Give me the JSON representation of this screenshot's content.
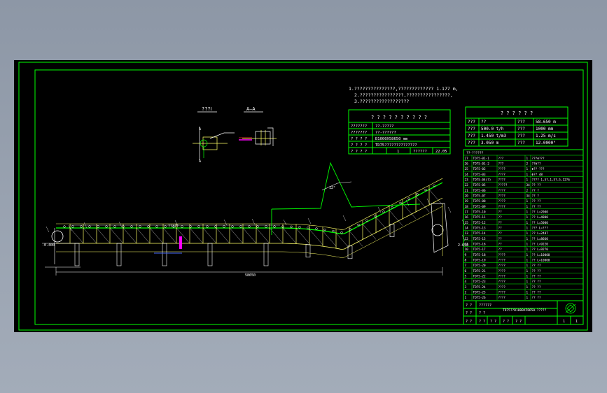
{
  "colors": {
    "background": "#000000",
    "frame": "#00ff00",
    "geometry": "#ffff66",
    "text": "#ffffff",
    "accent": "#ff00ff",
    "blue_line": "#4466ff",
    "canvas": "#9aa4b2"
  },
  "notes": {
    "line1": "1.???????????????,????????????? 1.177 m,",
    "line2": "2.????????????????,????????????????,",
    "line3": "3.??????????????????"
  },
  "section_labels": {
    "view1": "???Ⅰ",
    "view2": "A–A"
  },
  "spec_table": {
    "title": "? ? ? ? ? ? ? ? ? ?",
    "rows": [
      {
        "label": "???????",
        "value": "??-?????"
      },
      {
        "label": "???????",
        "value": "??-??????"
      },
      {
        "label": "? ? ? ?",
        "value": "B1000X58650 mm"
      },
      {
        "label": "? ? ? ?",
        "value": "TD75??????????????"
      }
    ],
    "footer": [
      "? ? ? ?",
      "1",
      "??????",
      "22.05"
    ]
  },
  "param_table": {
    "title": "? ? ? ? ? ?",
    "rows": [
      [
        "???",
        "??",
        "???",
        "58.650 m"
      ],
      [
        "???",
        "500.0 t/h",
        "???",
        "1000 mm"
      ],
      [
        "???",
        "1.450 t/m3",
        "???",
        "1.25 m/s"
      ],
      [
        "???",
        "3.050 m",
        "???",
        "12.0000°"
      ]
    ]
  },
  "parts_list": {
    "header": "??-??????",
    "rows": [
      [
        "27",
        "TD75-01-1",
        "???",
        "1",
        "???Φ???"
      ],
      [
        "26",
        "TD75-01-2",
        "???",
        "2",
        "??Φ??"
      ],
      [
        "25",
        "TD75-02",
        "????",
        "1",
        "Φ??-???"
      ],
      [
        "24",
        "TD75-03",
        "????",
        "1",
        "Φ?? 48"
      ],
      [
        "23",
        "TD75-04(?)",
        "????",
        "1",
        "???? 1,5?,1,5?,5,12?6"
      ],
      [
        "22",
        "TD75-05",
        "?????",
        "34",
        "?? ??"
      ],
      [
        "21",
        "TD75-06",
        "????",
        "2",
        "?? ?"
      ],
      [
        "20",
        "TD75-07",
        "????",
        "34",
        "?? ?"
      ],
      [
        "19",
        "TD75-08",
        "????",
        "1",
        "?? ??"
      ],
      [
        "18",
        "TD75-09",
        "????",
        "1",
        "?? ??"
      ],
      [
        "17",
        "TD75-10",
        "??",
        "1",
        "?? L=2000"
      ],
      [
        "16",
        "TD75-11",
        "??",
        "1",
        "?? L=4000"
      ],
      [
        "15",
        "TD75-12",
        "??",
        "1",
        "?? L=5000"
      ],
      [
        "14",
        "TD75-13",
        "??",
        "1",
        "??? L=???"
      ],
      [
        "13",
        "TD75-14",
        "??",
        "1",
        "?? L=2487"
      ],
      [
        "12",
        "TD75-15",
        "??",
        "1",
        "?? L=8660"
      ],
      [
        "11",
        "TD75-16",
        "??",
        "1",
        "?? L=9220"
      ],
      [
        "10",
        "TD75-17",
        "??",
        "1",
        "?? L=9270"
      ],
      [
        "9",
        "TD75-18",
        "????",
        "1",
        "?? L=10000"
      ],
      [
        "8",
        "TD75-19",
        "????",
        "1",
        "?? L=10000"
      ],
      [
        "7",
        "TD75-20",
        "????",
        "1",
        "?? ??"
      ],
      [
        "6",
        "TD75-21",
        "????",
        "1",
        "?? ??"
      ],
      [
        "5",
        "TD75-22",
        "????",
        "1",
        "?? ??"
      ],
      [
        "4",
        "TD75-23",
        "????",
        "1",
        "?? ??"
      ],
      [
        "3",
        "TD75-24",
        "????",
        "1",
        "?? ??"
      ],
      [
        "2",
        "TD75-25",
        "????",
        "1",
        "?? ??"
      ],
      [
        "1",
        "TD75-26",
        "????",
        "1",
        "?? ??"
      ]
    ]
  },
  "title_block": {
    "row1": [
      "? ?",
      "??????",
      "TD75??B1000X58650-?????"
    ],
    "row2": [
      "? ?",
      "? ?",
      ""
    ],
    "row3": [
      "? ?",
      "? ?",
      "? ?",
      "? ?",
      "? ?",
      "1",
      "1"
    ]
  },
  "dimensions": {
    "total_length": "58650",
    "horizontal_span": "?????",
    "incline_angle": "12°",
    "tail_height": "-0.400",
    "head_height": "2.650"
  }
}
